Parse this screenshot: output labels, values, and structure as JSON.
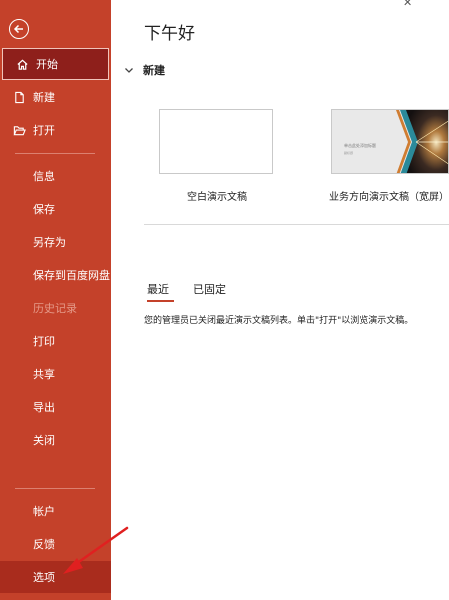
{
  "header": {
    "greeting": "下午好",
    "close_glyph": "✕"
  },
  "sidebar": {
    "back_icon": "back-arrow-icon",
    "items": [
      {
        "label": "开始",
        "icon": "home-icon",
        "state": "active"
      },
      {
        "label": "新建",
        "icon": "new-document-icon"
      },
      {
        "label": "打开",
        "icon": "open-folder-icon"
      },
      {
        "label": "信息"
      },
      {
        "label": "保存"
      },
      {
        "label": "另存为"
      },
      {
        "label": "保存到百度网盘"
      },
      {
        "label": "历史记录",
        "state": "disabled"
      },
      {
        "label": "打印"
      },
      {
        "label": "共享"
      },
      {
        "label": "导出"
      },
      {
        "label": "关闭"
      },
      {
        "label": "帐户"
      },
      {
        "label": "反馈"
      },
      {
        "label": "选项",
        "state": "hover"
      }
    ]
  },
  "new_section": {
    "title": "新建",
    "templates": [
      {
        "label": "空白演示文稿"
      },
      {
        "label": "业务方向演示文稿（宽屏）",
        "thumb_title": "单击此处添加标题",
        "thumb_sub": "副标题"
      }
    ]
  },
  "recent": {
    "tabs": [
      {
        "label": "最近",
        "selected": true
      },
      {
        "label": "已固定",
        "selected": false
      }
    ],
    "notice": "您的管理员已关闭最近演示文稿列表。单击\"打开\"以浏览演示文稿。"
  },
  "colors": {
    "sidebar": "#c4412a",
    "active": "#8e1f1b",
    "disabled_text": "#e59a89",
    "accent": "#c4412a",
    "arrow": "#e02020"
  }
}
